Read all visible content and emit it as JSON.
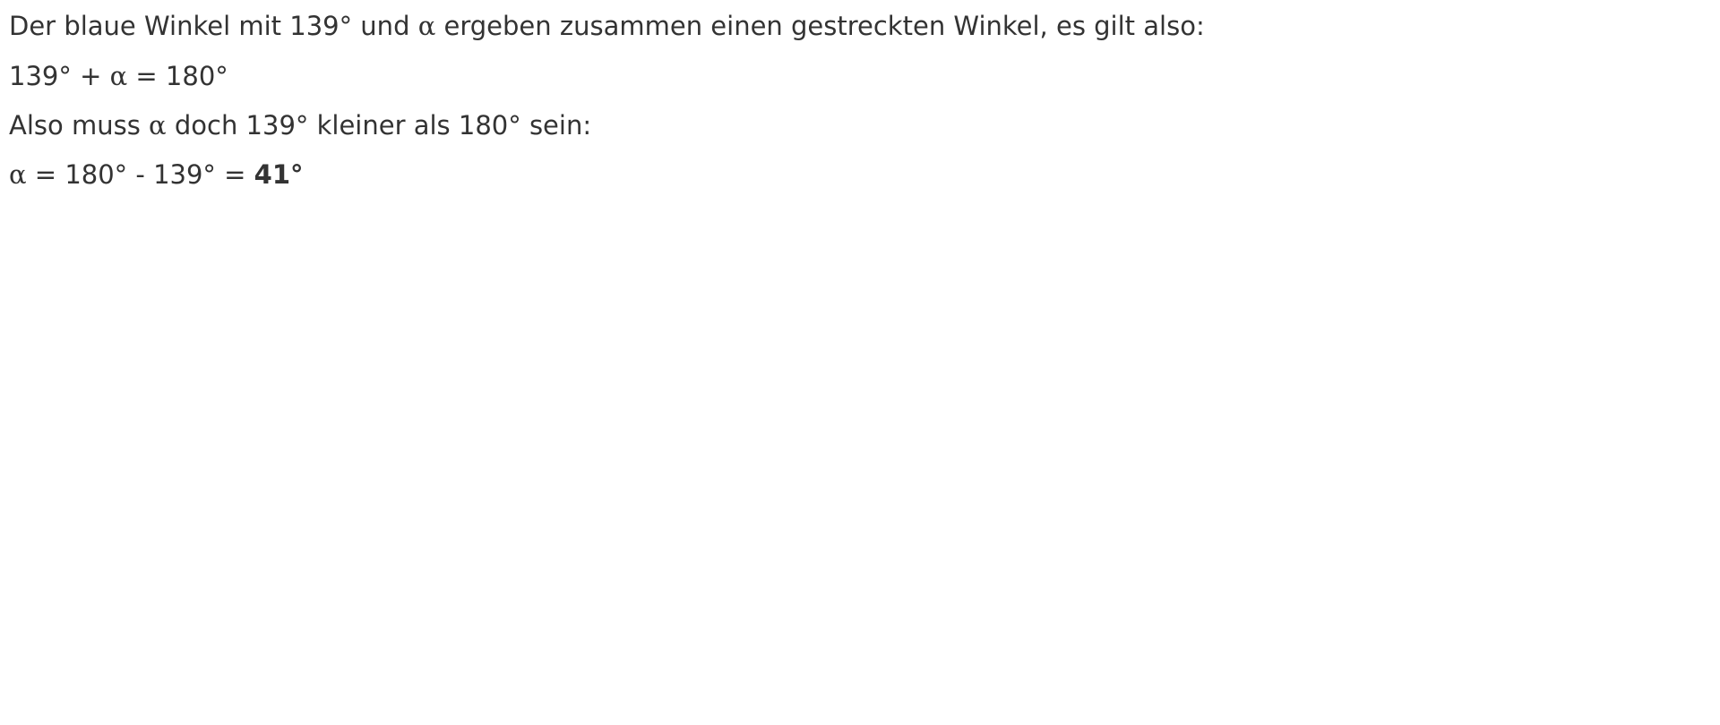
{
  "text": {
    "line1": {
      "before": "Der blaue Winkel mit 139° und ",
      "alpha": "α",
      "after": " ergeben zusammen einen gestreckten Winkel, es gilt also:"
    },
    "line2": {
      "before": "139° + ",
      "alpha": "α",
      "after": " = 180°"
    },
    "line3": {
      "before": "Also muss ",
      "alpha": "α",
      "after": " doch 139° kleiner als 180° sein:"
    },
    "line4": {
      "alpha": "α",
      "middle": " = 180° - 139° = ",
      "result": "41°"
    }
  },
  "colors": {
    "text": "#333333",
    "background": "#ffffff"
  }
}
